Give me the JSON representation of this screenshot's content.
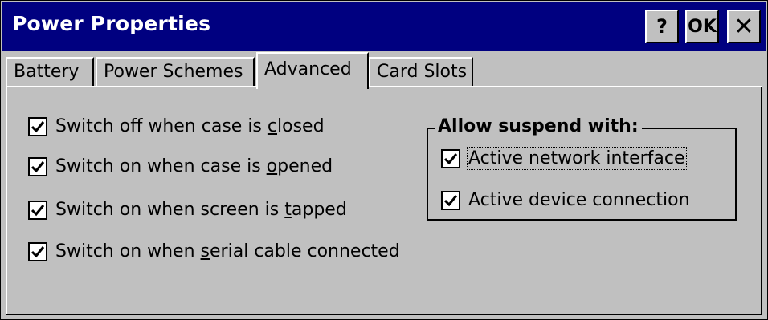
{
  "window": {
    "title": "Power Properties",
    "help_label": "?",
    "ok_label": "OK",
    "close_label": "✕"
  },
  "tabs": [
    {
      "label": "Battery"
    },
    {
      "label": "Power Schemes"
    },
    {
      "label": "Advanced",
      "active": true
    },
    {
      "label": "Card Slots"
    }
  ],
  "options": [
    {
      "pre": "Switch off when case is ",
      "key": "c",
      "post": "losed",
      "checked": true
    },
    {
      "pre": "Switch on when case is ",
      "key": "o",
      "post": "pened",
      "checked": true
    },
    {
      "pre": "Switch on when screen is ",
      "key": "t",
      "post": "apped",
      "checked": true
    },
    {
      "pre": "Switch on when ",
      "key": "s",
      "post": "erial cable connected",
      "checked": true
    }
  ],
  "suspend_group": {
    "title": "Allow suspend with:",
    "items": [
      {
        "label": "Active network interface",
        "checked": true
      },
      {
        "label": "Active device connection",
        "checked": true
      }
    ]
  },
  "colors": {
    "titlebar": "#000080",
    "face": "#c0c0c0"
  }
}
